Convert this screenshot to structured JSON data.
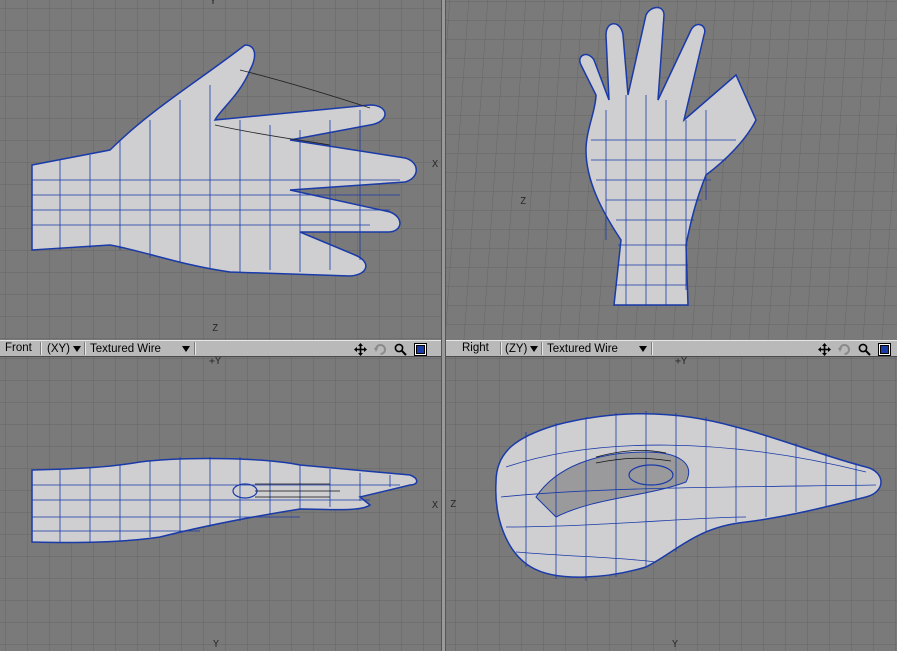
{
  "viewports": {
    "top_left": {
      "axis_top": "Y",
      "axis_right": "X",
      "axis_left": "X",
      "axis_bottom": "Z"
    },
    "top_right": {
      "axis_left": "Z"
    },
    "bottom_left": {
      "view_label": "Front",
      "plane_label": "(XY)",
      "mode_label": "Textured Wire",
      "axis_top": "+Y",
      "axis_right": "X",
      "axis_bottom": "Y"
    },
    "bottom_right": {
      "view_label": "Right",
      "plane_label": "(ZY)",
      "mode_label": "Textured Wire",
      "axis_top": "+Y",
      "axis_left": "Z",
      "axis_bottom": "Y"
    }
  },
  "colors": {
    "viewport_bg": "#7a7a7a",
    "grid": "#666666",
    "wire": "#1a3aa8",
    "mesh": "#cfcfd2",
    "toolbar": "#b9b9b9"
  },
  "icons": [
    "move-icon",
    "rotate-icon",
    "zoom-icon",
    "maximize-icon"
  ]
}
